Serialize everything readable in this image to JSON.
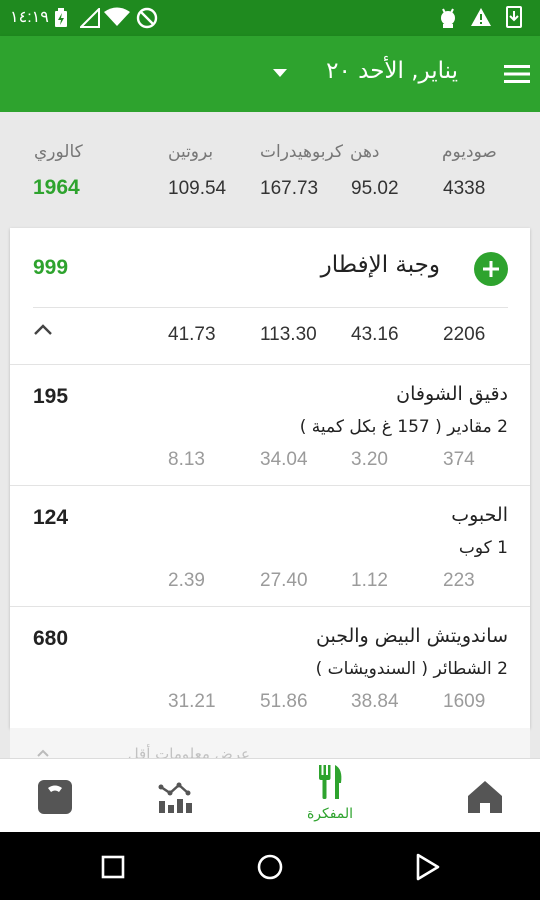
{
  "status_bar": {
    "time": "١٤:١٩",
    "colors": {
      "background": "#1f8a1f"
    }
  },
  "app_bar": {
    "title": "يناير, الأحد ٢٠",
    "colors": {
      "background": "#2ea32e"
    }
  },
  "summary": {
    "calories_label": "كالوري",
    "calories_value": "1964",
    "protein_label": "بروتين",
    "protein_value": "109.54",
    "carbs_label": "كربوهيدرات",
    "carbs_value": "167.73",
    "fat_label": "دهن",
    "fat_value": "95.02",
    "sodium_label": "صوديوم",
    "sodium_value": "4338",
    "colors": {
      "calories": "#2ea32e"
    }
  },
  "meal": {
    "title": "وجبة الإفطار",
    "calories": "999",
    "totals": {
      "protein": "41.73",
      "carbs": "113.30",
      "fat": "43.16",
      "sodium": "2206"
    },
    "items": [
      {
        "name": "دقيق الشوفان",
        "serving": "2 مقادير ( 157 غ بكل كمية )",
        "calories": "195",
        "protein": "8.13",
        "carbs": "34.04",
        "fat": "3.20",
        "sodium": "374"
      },
      {
        "name": "الحبوب",
        "serving": "1 كوب",
        "calories": "124",
        "protein": "2.39",
        "carbs": "27.40",
        "fat": "1.12",
        "sodium": "223"
      },
      {
        "name": "ساندويتش البيض والجبن",
        "serving": "2 الشطائر ( السندويشات )",
        "calories": "680",
        "protein": "31.21",
        "carbs": "51.86",
        "fat": "38.84",
        "sodium": "1609"
      }
    ]
  },
  "peek_text": "عرض معلومات أقل",
  "bottom_nav": {
    "items": [
      {
        "label": "",
        "icon": "scale-icon"
      },
      {
        "label": "",
        "icon": "chart-icon"
      },
      {
        "label": "المفكرة",
        "icon": "fork-knife-icon"
      },
      {
        "label": "",
        "icon": "home-icon"
      }
    ],
    "colors": {
      "active": "#2ea32e",
      "inactive": "#555555"
    }
  }
}
